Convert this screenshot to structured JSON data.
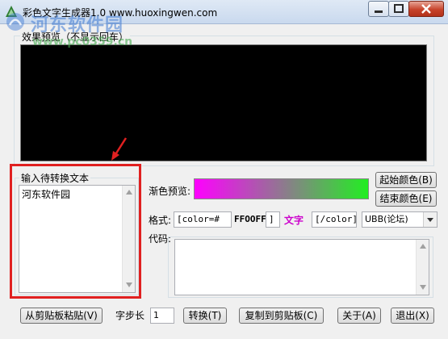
{
  "window": {
    "title": "彩色文字生成器1.0  www.huoxingwen.com"
  },
  "watermark": {
    "text1": "河东软件园",
    "text2": "www.pc0359.cn"
  },
  "preview": {
    "group_label": "效果预览（不显示回车）"
  },
  "input": {
    "group_label": "输入待转换文本",
    "value": "河东软件园"
  },
  "gradient": {
    "label": "渐色预览:",
    "start_color": "#ff00ff",
    "end_color": "#22ee22",
    "start_button": "起始颜色(B)",
    "end_button": "结束颜色(E)"
  },
  "format": {
    "label": "格式:",
    "open_tag": "[color=#",
    "color_code": "FFOOFF",
    "close_bracket": "]",
    "sample": "文字",
    "sample_color": "#cc00cc",
    "end_tag": "[/color]",
    "select_value": "UBB(论坛)"
  },
  "code": {
    "label": "代码:"
  },
  "bottom": {
    "paste_button": "从剪贴板粘贴(V)",
    "step_label": "字步长",
    "step_value": "1",
    "convert_button": "转换(T)",
    "copy_button": "复制到剪贴板(C)",
    "about_button": "关于(A)",
    "exit_button": "退出(X)"
  },
  "colors": {
    "highlight_frame": "#e02020",
    "arrow": "#e02020"
  }
}
